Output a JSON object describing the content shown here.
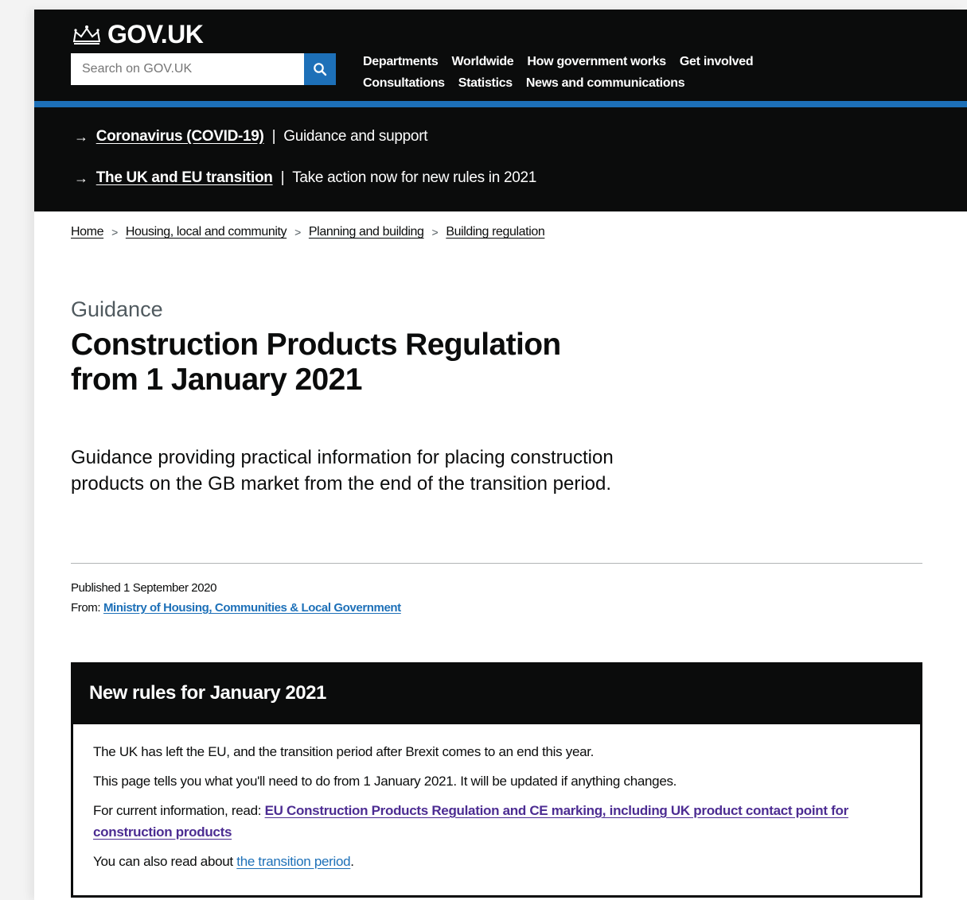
{
  "header": {
    "logo_text": "GOV.UK",
    "search_placeholder": "Search on GOV.UK",
    "nav_row1": [
      "Departments",
      "Worldwide",
      "How government works",
      "Get involved"
    ],
    "nav_row2": [
      "Consultations",
      "Statistics",
      "News and communications"
    ]
  },
  "banner": {
    "items": [
      {
        "link": "Coronavirus (COVID-19)",
        "text": "Guidance and support"
      },
      {
        "link": "The UK and EU transition",
        "text": "Take action now for new rules in 2021"
      }
    ]
  },
  "breadcrumb": [
    "Home",
    "Housing, local and community",
    "Planning and building",
    "Building regulation"
  ],
  "page": {
    "caption": "Guidance",
    "title": "Construction Products Regulation from 1 January 2021",
    "lead": "Guidance providing practical information for placing construction products on the GB market from the end of the transition period."
  },
  "meta": {
    "published": "Published 1 September 2020",
    "from_label": "From:",
    "from_link": "Ministry of Housing, Communities & Local Government"
  },
  "callout": {
    "heading": "New rules for January 2021",
    "p1": "The UK has left the EU, and the transition period after Brexit comes to an end this year.",
    "p2": "This page tells you what you'll need to do from 1 January 2021. It will be updated if anything changes.",
    "p3_prefix": "For current information, read:",
    "p3_link": "EU Construction Products Regulation and CE marking, including UK product contact point for construction products",
    "p4_prefix": "You can also read about",
    "p4_link": "the transition period",
    "p4_suffix": "."
  },
  "colors": {
    "header_bg": "#0b0c0c",
    "accent_blue": "#1d70b8",
    "visited_link": "#4c2c92"
  }
}
